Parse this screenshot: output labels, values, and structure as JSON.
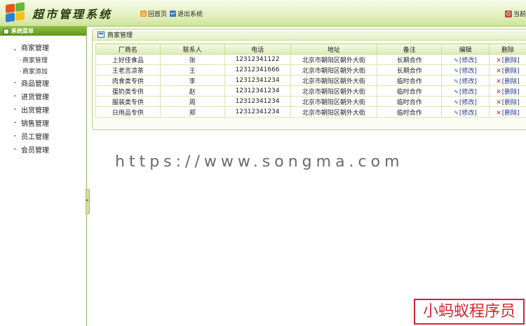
{
  "header": {
    "app_title": "超市管理系统",
    "nav": [
      {
        "label": "回首页",
        "icon": "home-icon"
      },
      {
        "label": "退出系统",
        "icon": "exit-icon"
      }
    ],
    "right_label": "当前"
  },
  "sidebar": {
    "title": "系统菜单",
    "groups": [
      {
        "label": "商家管理",
        "expanded": true,
        "items": [
          {
            "label": "商家管理"
          },
          {
            "label": "商家添加"
          }
        ]
      },
      {
        "label": "商品管理",
        "expanded": false
      },
      {
        "label": "进货管理",
        "expanded": false
      },
      {
        "label": "出货管理",
        "expanded": false
      },
      {
        "label": "销售管理",
        "expanded": false
      },
      {
        "label": "员工管理",
        "expanded": false
      },
      {
        "label": "会员管理",
        "expanded": false
      }
    ]
  },
  "panel": {
    "title": "商家管理",
    "columns": [
      "厂商名",
      "联系人",
      "电话",
      "地址",
      "备注",
      "编辑",
      "删除"
    ],
    "rows": [
      {
        "name": "上好佳食品",
        "contact": "张",
        "phone": "12312341122",
        "address": "北京市朝阳区朝外大街",
        "note": "长期合作",
        "edit": "[修改]",
        "delete": "[删除]"
      },
      {
        "name": "王老吉凉茶",
        "contact": "王",
        "phone": "12312341666",
        "address": "北京市朝阳区朝外大街",
        "note": "长期合作",
        "edit": "[修改]",
        "delete": "[删除]"
      },
      {
        "name": "肉食类专供",
        "contact": "李",
        "phone": "12312341234",
        "address": "北京市朝阳区朝外大街",
        "note": "临时合作",
        "edit": "[修改]",
        "delete": "[删除]"
      },
      {
        "name": "蛋奶类专供",
        "contact": "赵",
        "phone": "12312341234",
        "address": "北京市朝阳区朝外大街",
        "note": "临时合作",
        "edit": "[修改]",
        "delete": "[删除]"
      },
      {
        "name": "服装类专供",
        "contact": "周",
        "phone": "12312341234",
        "address": "北京市朝阳区朝外大街",
        "note": "临时合作",
        "edit": "[修改]",
        "delete": "[删除]"
      },
      {
        "name": "日用品专供",
        "contact": "郑",
        "phone": "12312341234",
        "address": "北京市朝阳区朝外大街",
        "note": "临时合作",
        "edit": "[修改]",
        "delete": "[删除]"
      }
    ]
  },
  "watermark": "https://www.songma.com",
  "stamp": "小蚂蚁程序员",
  "colors": {
    "accent_green": "#5f9421",
    "delete_red": "#c8261e",
    "link_blue": "#2a3a8c",
    "stamp_red": "#d4262a"
  }
}
